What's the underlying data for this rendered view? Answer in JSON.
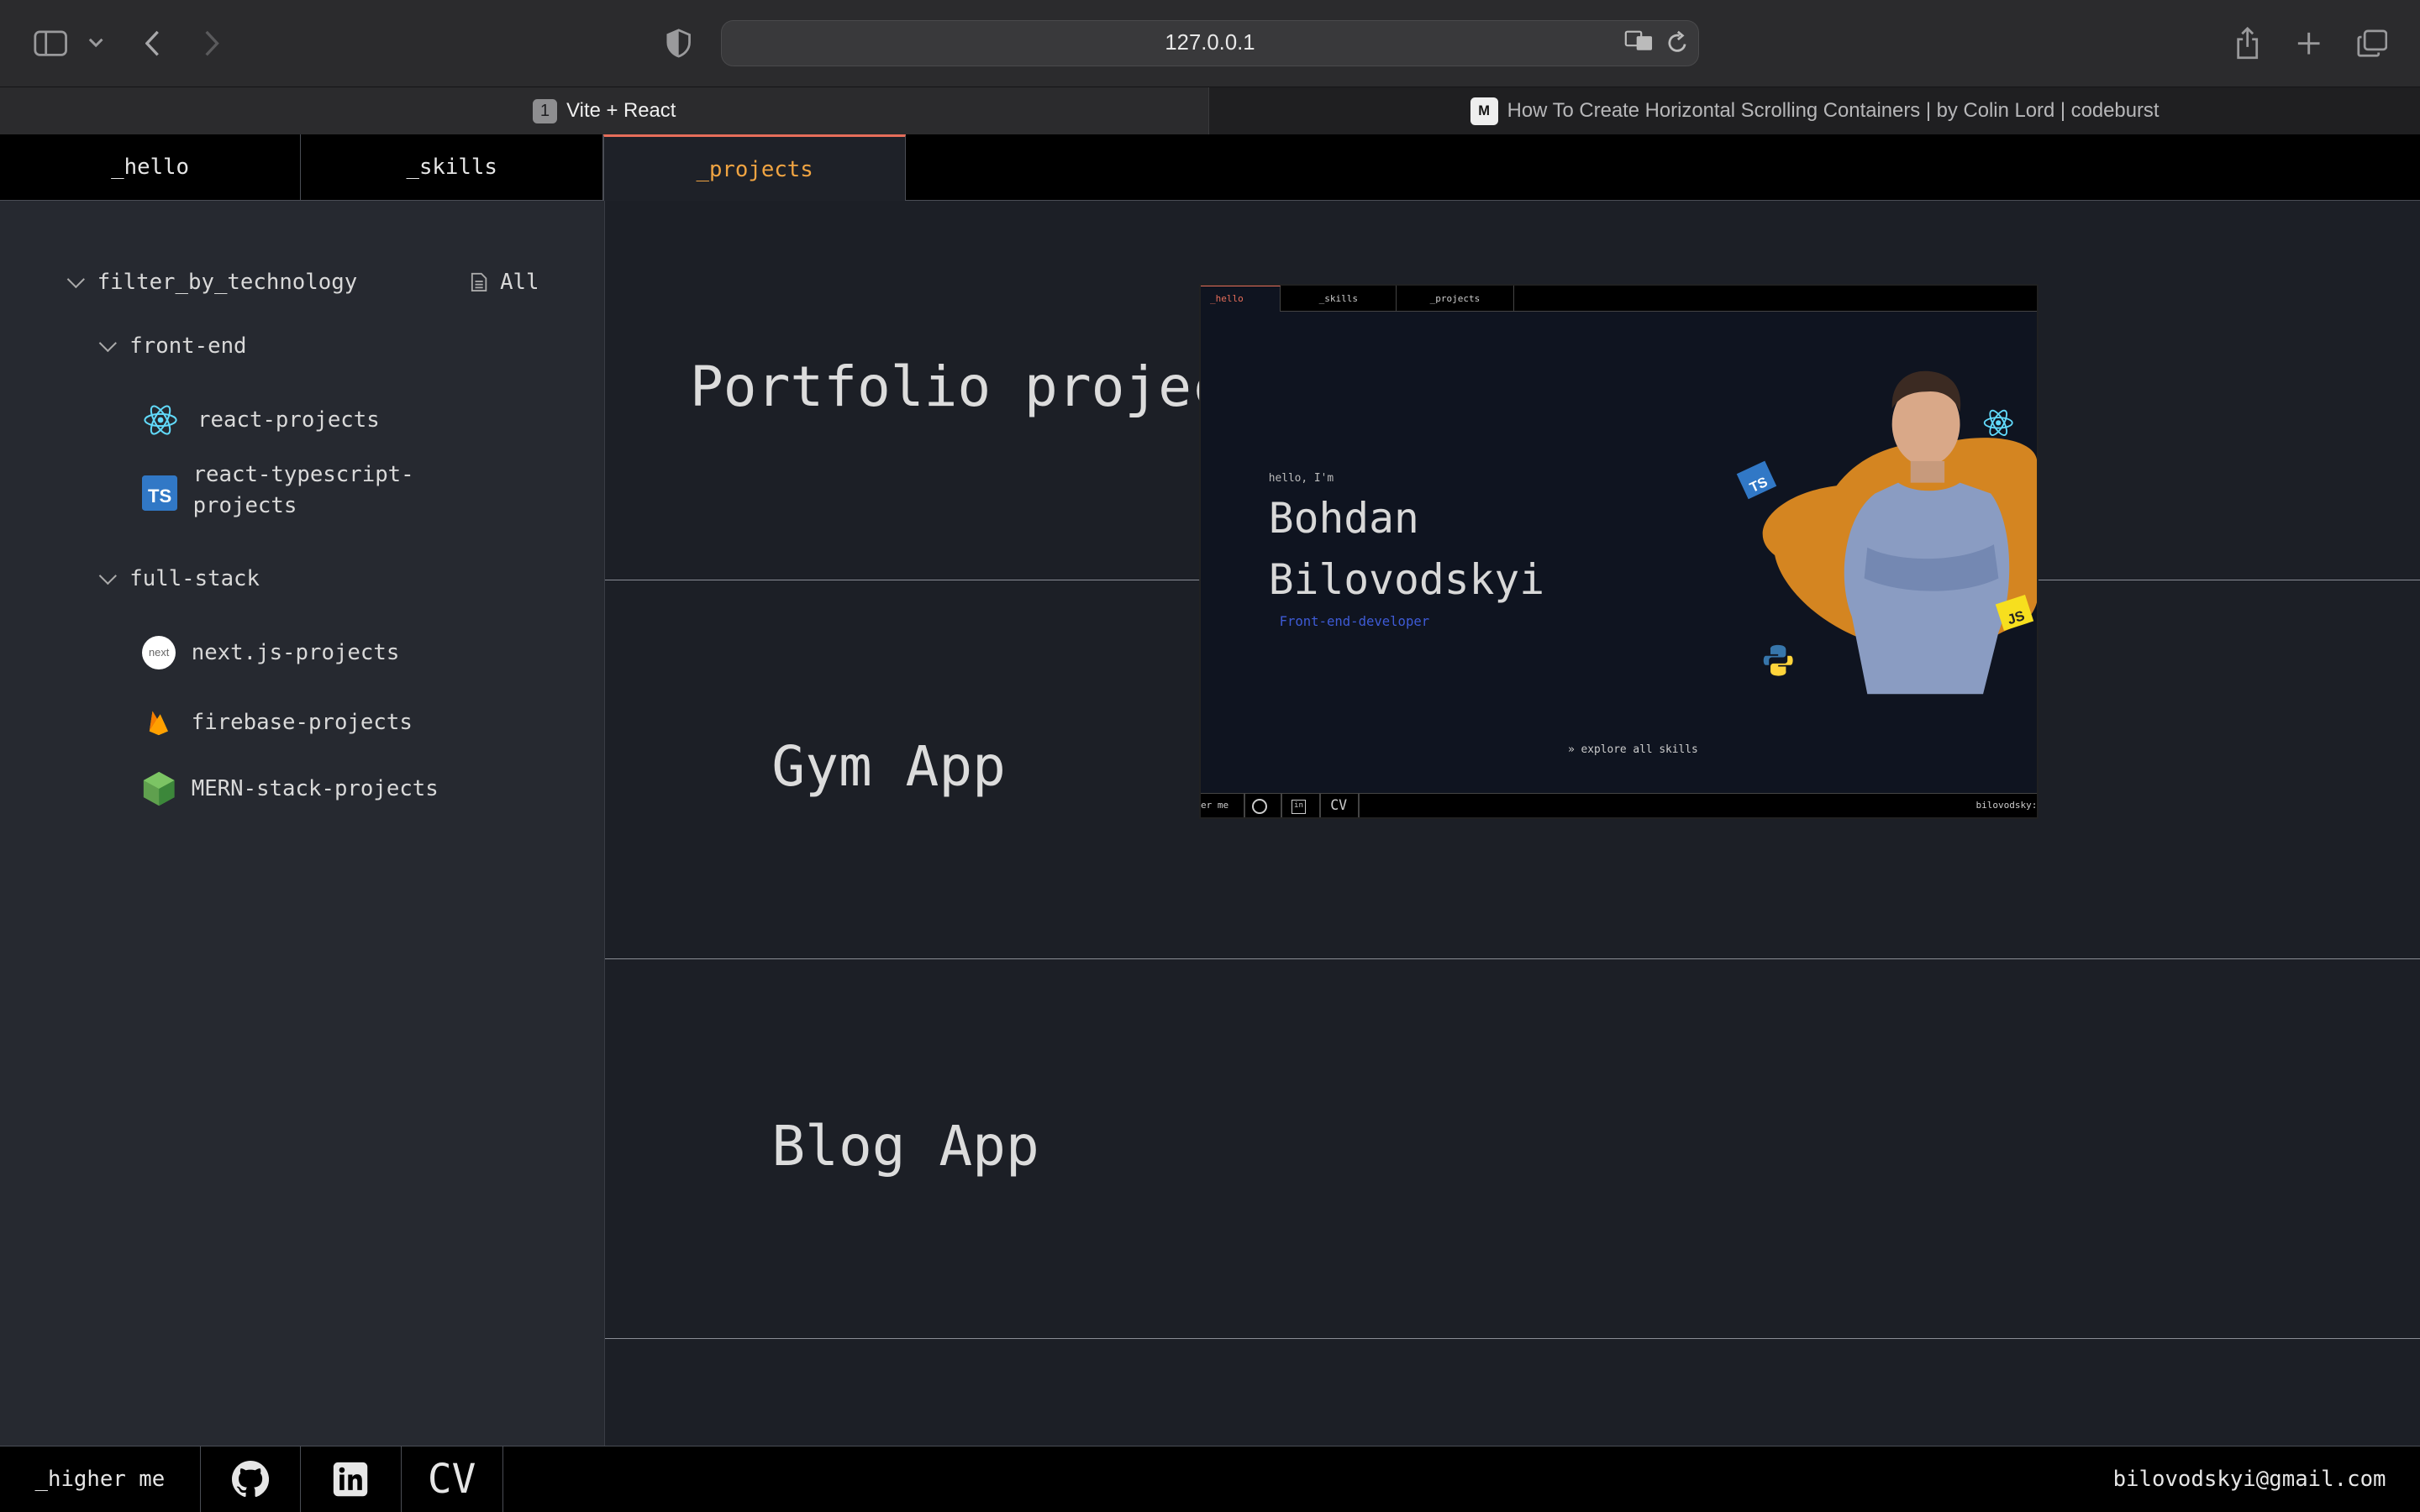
{
  "browser": {
    "url": "127.0.0.1",
    "tabs": [
      {
        "number": "1",
        "title": "Vite + React"
      },
      {
        "favicon": "M",
        "title": "How To Create Horizontal Scrolling Containers | by Colin Lord | codeburst"
      }
    ]
  },
  "nav": {
    "tabs": [
      "_hello",
      "_skills",
      "_projects"
    ],
    "active": "_projects"
  },
  "sidebar": {
    "filter_title": "filter_by_technology",
    "all_label": "All",
    "groups": [
      {
        "label": "front-end",
        "items": [
          {
            "label": "react-projects",
            "icon": "react-icon"
          },
          {
            "label": "react-typescript-projects",
            "line1": "react-typescript-",
            "line2": "projects",
            "icon": "typescript-icon"
          }
        ]
      },
      {
        "label": "full-stack",
        "items": [
          {
            "label": "next.js-projects",
            "icon": "nextjs-icon"
          },
          {
            "label": "firebase-projects",
            "icon": "firebase-icon"
          },
          {
            "label": "MERN-stack-projects",
            "icon": "nodejs-icon"
          }
        ]
      }
    ]
  },
  "projects": [
    {
      "title": "Portfolio project (this website)"
    },
    {
      "title": "Gym App"
    },
    {
      "title": "Blog App"
    }
  ],
  "preview": {
    "tabs": [
      "_hello",
      "_skills",
      "_projects"
    ],
    "greeting": "hello, I'm",
    "first_name": "Bohdan",
    "last_name": "Bilovodskyi",
    "role": "Front-end-developer",
    "explore": "explore all skills",
    "footer_left": "er me",
    "footer_cv": "CV",
    "footer_right": "bilovodsky:",
    "badges": {
      "ts": "TS",
      "js": "JS"
    }
  },
  "footer": {
    "hire": "_higher me",
    "cv": "CV",
    "email": "bilovodskyi@gmail.com"
  },
  "colors": {
    "accent_orange": "#f0a442",
    "active_border": "#e76e5a",
    "role_blue": "#3e5bd6"
  }
}
